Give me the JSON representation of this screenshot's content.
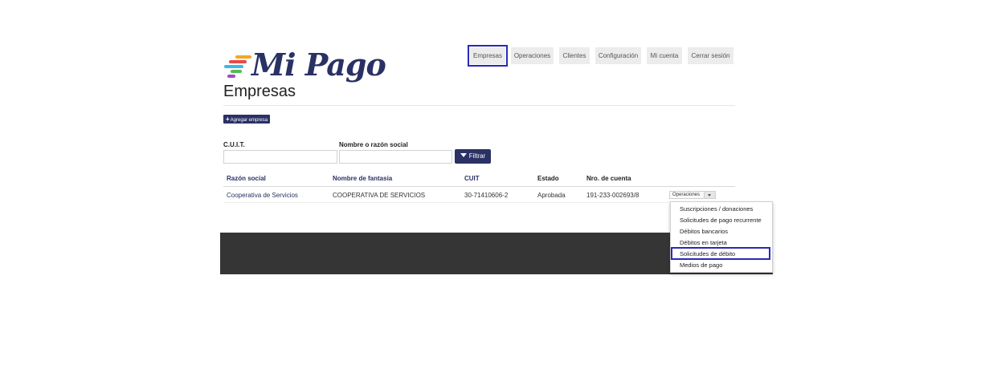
{
  "brand": {
    "logo_text": "Mi Pago",
    "colors": {
      "primary": "#2a3164",
      "highlight": "#2929b8",
      "footer": "#353535"
    }
  },
  "nav": {
    "items": [
      {
        "label": "Empresas"
      },
      {
        "label": "Operaciones"
      },
      {
        "label": "Clientes"
      },
      {
        "label": "Configuración"
      },
      {
        "label": "Mi cuenta"
      },
      {
        "label": "Cerrar sesión"
      }
    ]
  },
  "page": {
    "title": "Empresas",
    "add_button": "Agregar empresa"
  },
  "filters": {
    "cuit_label": "C.U.I.T.",
    "cuit_value": "",
    "name_label": "Nombre o razón social",
    "name_value": "",
    "filter_button": "Filtrar"
  },
  "table": {
    "headers": [
      "Razón social",
      "Nombre de fantasia",
      "CUIT",
      "Estado",
      "Nro. de cuenta"
    ],
    "rows": [
      {
        "razon_social": "Cooperativa de Servicios",
        "nombre_fantasia": "COOPERATIVA DE SERVICIOS",
        "cuit": "30-71410606-2",
        "estado": "Aprobada",
        "nro_cuenta": "191-233-002693/8",
        "ops_label": "Operaciones"
      }
    ]
  },
  "dropdown": {
    "items": [
      "Suscripciones / donaciones",
      "Solicitudes de pago recurrente",
      "Débitos bancarios",
      "Débitos en tarjeta",
      "Solicitudes de débito",
      "Medios de pago"
    ]
  }
}
